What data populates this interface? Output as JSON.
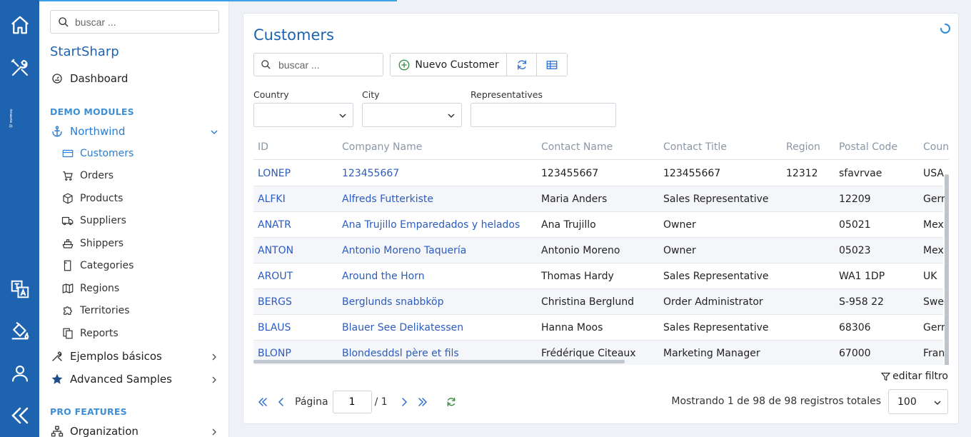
{
  "sidebar": {
    "search_placeholder": "buscar ...",
    "brand": "StartSharp",
    "dashboard": "Dashboard",
    "section_demo": "DEMO MODULES",
    "northwind": "Northwind",
    "items": [
      "Customers",
      "Orders",
      "Products",
      "Suppliers",
      "Shippers",
      "Categories",
      "Regions",
      "Territories",
      "Reports"
    ],
    "ejemplos": "Ejemplos básicos",
    "advanced": "Advanced Samples",
    "section_pro": "PRO FEATURES",
    "organization": "Organization"
  },
  "rail": {
    "brand_text": "StartSharp"
  },
  "main": {
    "title": "Customers",
    "search_placeholder": "buscar ...",
    "new_button": "Nuevo Customer",
    "filters": {
      "country": "Country",
      "city": "City",
      "representatives": "Representatives"
    },
    "columns": [
      "ID",
      "Company Name",
      "Contact Name",
      "Contact Title",
      "Region",
      "Postal Code",
      "Coun"
    ],
    "rows": [
      [
        "LONEP",
        "123455667",
        "123455667",
        "123455667",
        "12312",
        "sfavrvae",
        "USA"
      ],
      [
        "ALFKI",
        "Alfreds Futterkiste",
        "Maria Anders",
        "Sales Representative",
        "",
        "12209",
        "Gern"
      ],
      [
        "ANATR",
        "Ana Trujillo Emparedados y helados",
        "Ana Trujillo",
        "Owner",
        "",
        "05021",
        "Mex"
      ],
      [
        "ANTON",
        "Antonio Moreno Taquería",
        "Antonio Moreno",
        "Owner",
        "",
        "05023",
        "Mex"
      ],
      [
        "AROUT",
        "Around the Horn",
        "Thomas Hardy",
        "Sales Representative",
        "",
        "WA1 1DP",
        "UK"
      ],
      [
        "BERGS",
        "Berglunds snabbköp",
        "Christina Berglund",
        "Order Administrator",
        "",
        "S-958 22",
        "Swed"
      ],
      [
        "BLAUS",
        "Blauer See Delikatessen",
        "Hanna Moos",
        "Sales Representative",
        "",
        "68306",
        "Gern"
      ],
      [
        "BLONP",
        "Blondesddsl père et fils",
        "Frédérique Citeaux",
        "Marketing Manager",
        "",
        "67000",
        "Fran"
      ]
    ],
    "edit_filter": "editar filtro",
    "pager": {
      "page_label": "Página",
      "page_value": "1",
      "of_text": "/ 1",
      "total_text": "Mostrando 1 de 98 de 98 registros totales",
      "page_size": "100"
    }
  },
  "colors": {
    "accent": "#1e63b0",
    "link": "#2c5cbf",
    "section": "#3f8fd4"
  }
}
